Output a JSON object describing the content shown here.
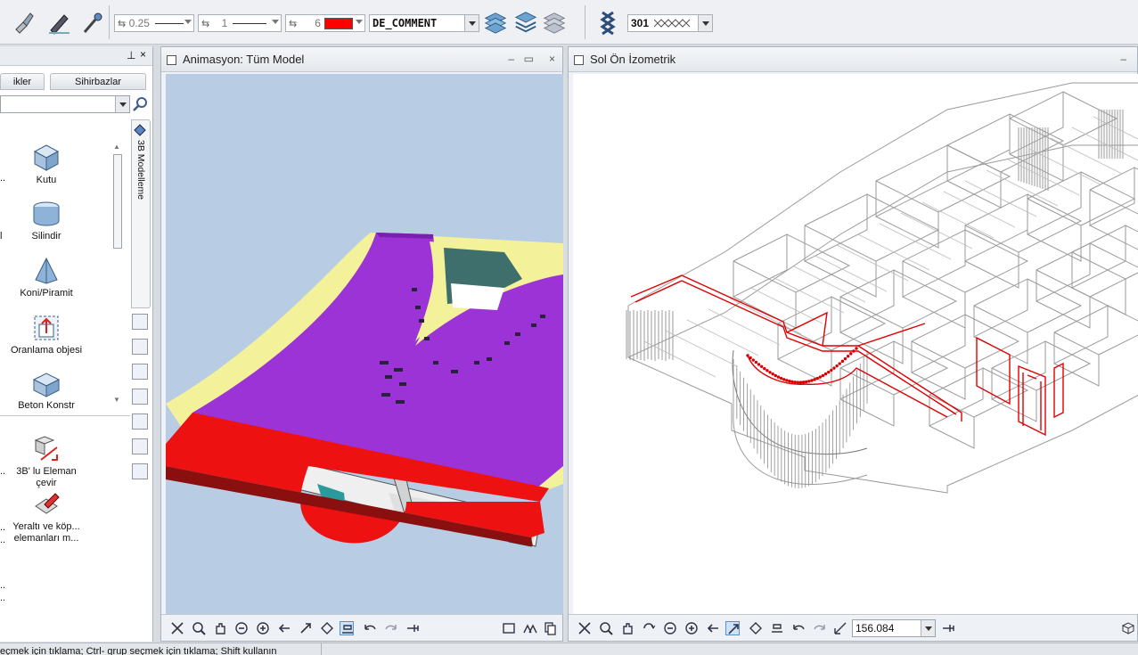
{
  "toolbar": {
    "pen_thickness": "0.25",
    "line_type": "1",
    "color_index": "6",
    "color_hex": "#ff0000",
    "layer": "DE_COMMENT",
    "pattern_number": "301",
    "icons": [
      "brush-icon",
      "pencil-icon",
      "eyedropper-icon",
      "layers-down-icon",
      "layers-stack-icon",
      "layers-up-icon",
      "chain-icon"
    ]
  },
  "left_panel": {
    "tabs": [
      "ikler",
      "Sihirbazlar"
    ],
    "vertical_tab": "3B Modelleme",
    "tools": [
      {
        "label": "Kutu",
        "icon": "cube-icon"
      },
      {
        "label": "Silindir",
        "icon": "cylinder-icon"
      },
      {
        "label": "Koni/Piramit",
        "icon": "cone-icon"
      },
      {
        "label": "Oranlama objesi",
        "icon": "scale-object-icon"
      },
      {
        "label": "Beton Konstr",
        "icon": "concrete-icon"
      },
      {
        "label": "3B' lu Eleman çevir",
        "icon": "convert-element-icon"
      },
      {
        "label": "Yeraltı ve köp... elemanları m...",
        "icon": "eraser-tool-icon"
      }
    ],
    "truncated": [
      "..",
      "l",
      "..",
      "..",
      "..",
      "..",
      ".."
    ]
  },
  "windows": {
    "animation": {
      "title": "Animasyon: Tüm Model"
    },
    "iso": {
      "title": "Sol Ön İzometrik",
      "scale": "156.084"
    }
  },
  "status": {
    "text": "eçmek için tıklama; Ctrl- grup seçmek için tıklama; Shift kullanın"
  },
  "colors": {
    "viewport_bg": "#b8cde3",
    "floor_purple": "#9b33d6",
    "slab_red": "#ee1111",
    "edge_yellow": "#f3f29a",
    "wire_red": "#e00000"
  }
}
